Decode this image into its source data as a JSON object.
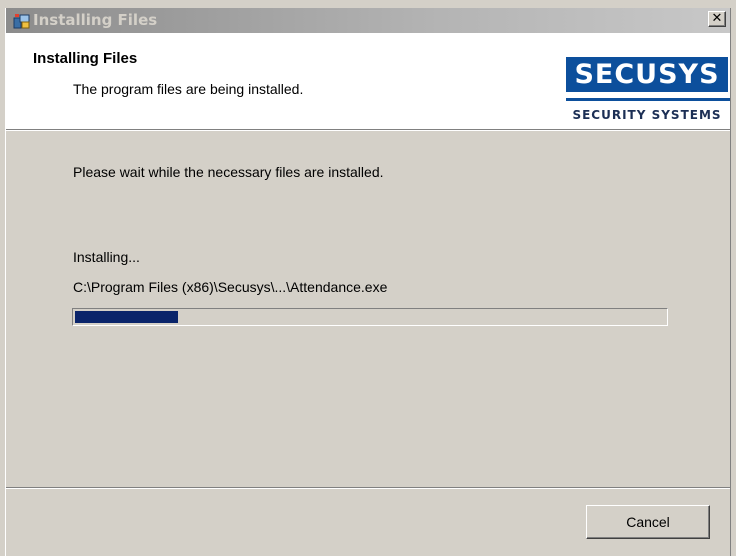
{
  "window": {
    "title": "Installing Files",
    "close_label": "✕"
  },
  "header": {
    "title": "Installing Files",
    "subtitle": "The program files are being installed.",
    "logo": {
      "name": "SECUSYS",
      "tagline": "SECURITY SYSTEMS"
    }
  },
  "main": {
    "wait_message": "Please wait while the necessary files are installed.",
    "status_label": "Installing...",
    "current_file": "C:\\Program Files (x86)\\Secusys\\...\\Attendance.exe",
    "progress_fraction": 0.175
  },
  "footer": {
    "cancel_label": "Cancel"
  },
  "colors": {
    "accent": "#0c4f9c",
    "progress_fill": "#0a246a",
    "dialog_bg": "#d4d0c8",
    "header_bg": "#ffffff"
  },
  "icons": {
    "window_icon": "installer-icon",
    "close_icon": "close-icon"
  }
}
